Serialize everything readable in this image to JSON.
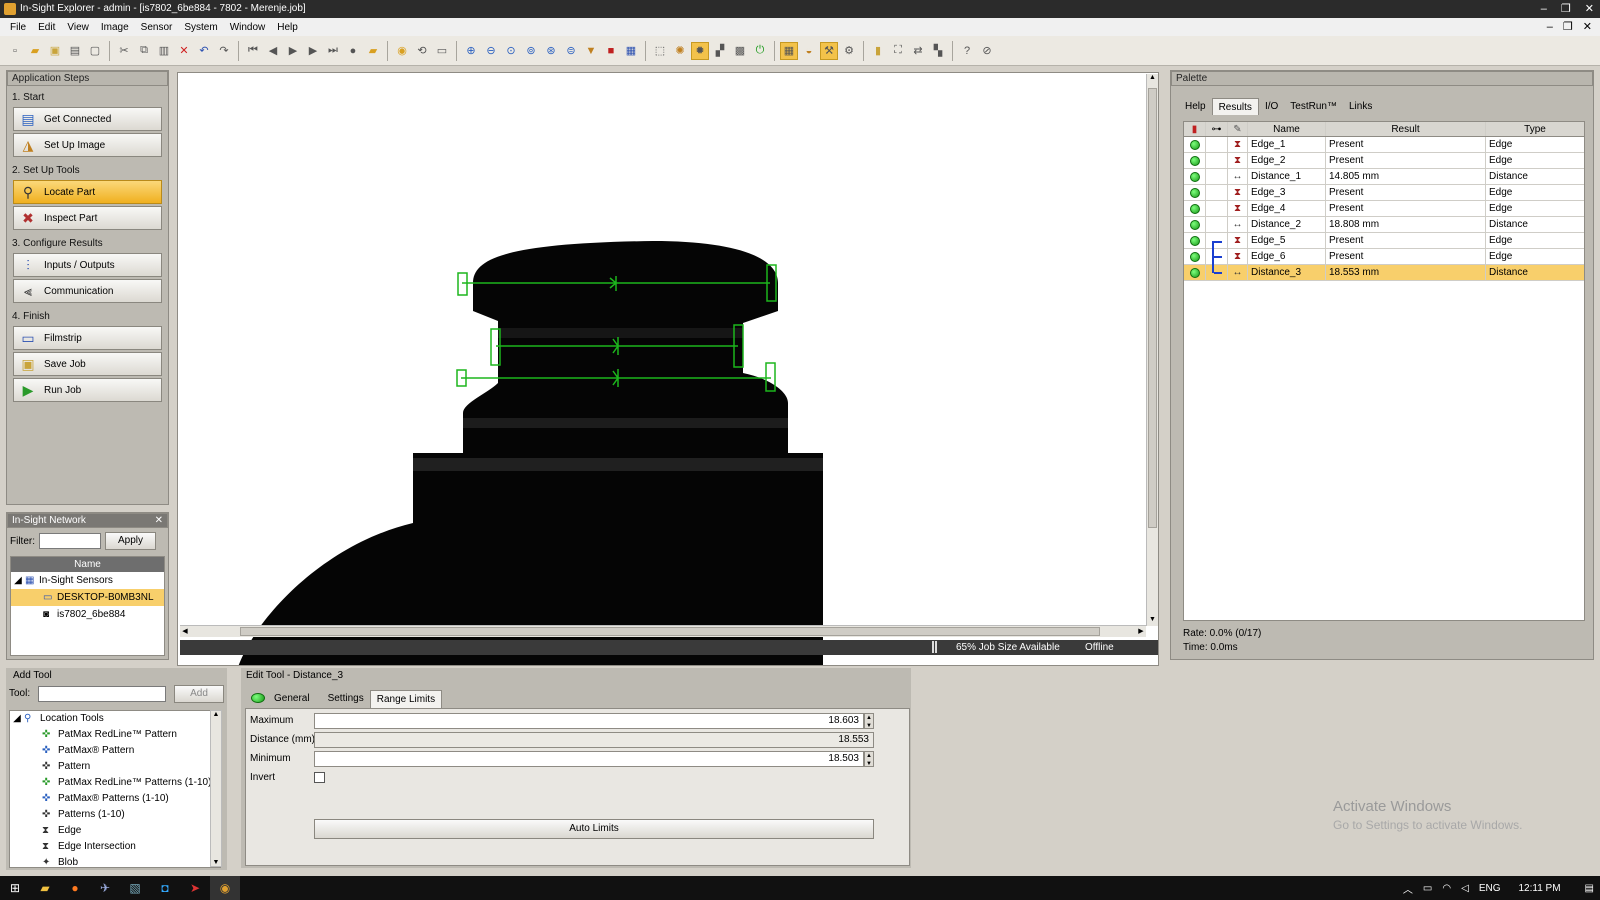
{
  "window": {
    "title": "In-Sight Explorer - admin - [is7802_6be884 - 7802 - Merenje.job]"
  },
  "menu": [
    "File",
    "Edit",
    "View",
    "Image",
    "Sensor",
    "System",
    "Window",
    "Help"
  ],
  "app_steps": {
    "header": "Application Steps",
    "sections": [
      {
        "label": "1. Start",
        "items": [
          "Get Connected",
          "Set Up Image"
        ]
      },
      {
        "label": "2. Set Up Tools",
        "items": [
          "Locate Part",
          "Inspect Part"
        ]
      },
      {
        "label": "3. Configure Results",
        "items": [
          "Inputs / Outputs",
          "Communication"
        ]
      },
      {
        "label": "4. Finish",
        "items": [
          "Filmstrip",
          "Save Job",
          "Run Job"
        ]
      }
    ],
    "active": "Locate Part"
  },
  "network": {
    "header": "In-Sight Network",
    "filter_label": "Filter:",
    "filter_value": "",
    "apply": "Apply",
    "col_name": "Name",
    "root": "In-Sight Sensors",
    "items": [
      "DESKTOP-B0MB3NL",
      "is7802_6be884"
    ]
  },
  "image_status": {
    "job_size": "65% Job Size Available",
    "mode": "Offline"
  },
  "palette": {
    "header": "Palette",
    "tabs": [
      "Help",
      "Results",
      "I/O",
      "TestRun™",
      "Links"
    ],
    "selected_tab": "Results",
    "columns": [
      "Name",
      "Result",
      "Type"
    ],
    "rows": [
      {
        "name": "Edge_1",
        "result": "Present",
        "type": "Edge"
      },
      {
        "name": "Edge_2",
        "result": "Present",
        "type": "Edge"
      },
      {
        "name": "Distance_1",
        "result": "14.805 mm",
        "type": "Distance"
      },
      {
        "name": "Edge_3",
        "result": "Present",
        "type": "Edge"
      },
      {
        "name": "Edge_4",
        "result": "Present",
        "type": "Edge"
      },
      {
        "name": "Distance_2",
        "result": "18.808 mm",
        "type": "Distance"
      },
      {
        "name": "Edge_5",
        "result": "Present",
        "type": "Edge"
      },
      {
        "name": "Edge_6",
        "result": "Present",
        "type": "Edge"
      },
      {
        "name": "Distance_3",
        "result": "18.553 mm",
        "type": "Distance"
      }
    ],
    "selected_row": "Distance_3",
    "rate": "Rate: 0.0% (0/17)",
    "time": "Time: 0.0ms"
  },
  "add_tool": {
    "header": "Add Tool",
    "tool_label": "Tool:",
    "tool_value": "",
    "add": "Add",
    "group": "Location Tools",
    "items": [
      "PatMax RedLine™ Pattern",
      "PatMax® Pattern",
      "Pattern",
      "PatMax RedLine™ Patterns (1-10)",
      "PatMax® Patterns (1-10)",
      "Patterns (1-10)",
      "Edge",
      "Edge Intersection",
      "Blob"
    ]
  },
  "edit_tool": {
    "header": "Edit Tool - Distance_3",
    "tabs": [
      "General",
      "Settings",
      "Range Limits"
    ],
    "selected_tab": "Range Limits",
    "maximum_label": "Maximum",
    "maximum": "18.603",
    "distance_label": "Distance (mm)",
    "distance": "18.553",
    "minimum_label": "Minimum",
    "minimum": "18.503",
    "invert_label": "Invert",
    "auto_limits": "Auto Limits"
  },
  "watermark": {
    "title": "Activate Windows",
    "sub": "Go to Settings to activate Windows."
  },
  "taskbar": {
    "lang": "ENG",
    "time": "12:11 PM"
  }
}
